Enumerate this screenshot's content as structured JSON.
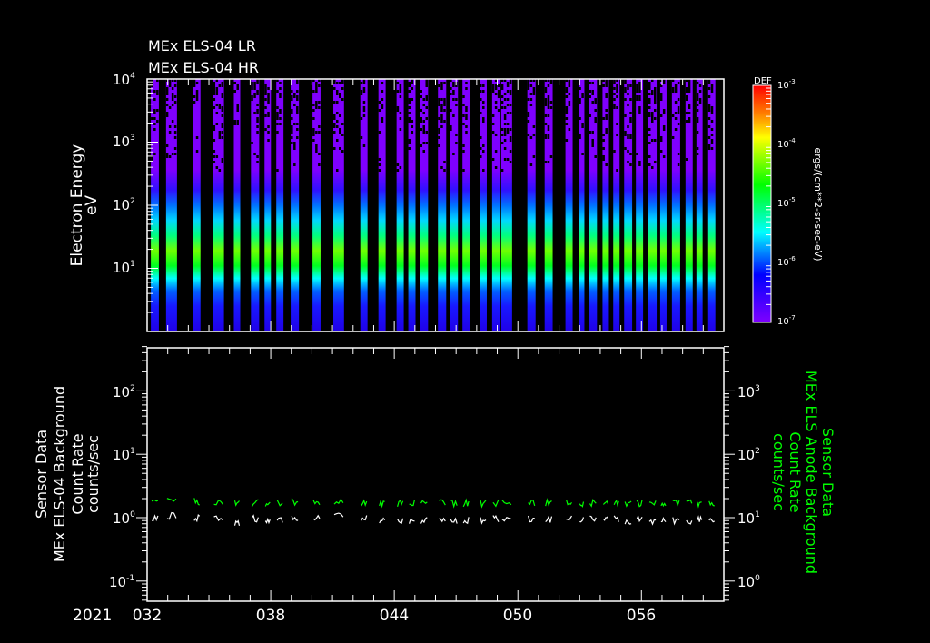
{
  "colors": {
    "background": "#000000",
    "axis": "#ffffff",
    "green_trace": "#00ff00",
    "white_trace": "#ffffff"
  },
  "chart_data": [
    {
      "type": "heatmap",
      "title_lines": [
        "MEx ELS-04 LR",
        "MEx ELS-04 HR"
      ],
      "ylabel": "Electron Energy",
      "yunit": "eV",
      "yscale": "log",
      "ylim": [
        1,
        10000
      ],
      "yticks": [
        {
          "base": "10",
          "exp": "4"
        },
        {
          "base": "10",
          "exp": "3"
        },
        {
          "base": "10",
          "exp": "2"
        },
        {
          "base": "10",
          "exp": "1"
        }
      ],
      "xlim_day": [
        32,
        60
      ],
      "colorbar": {
        "label": "DEF",
        "unit": "ergs/(cm**2-sr-sec-eV)",
        "scale": "log",
        "range": [
          1e-07,
          0.001
        ],
        "ticks": [
          {
            "base": "10",
            "exp": "-3"
          },
          {
            "base": "10",
            "exp": "-4"
          },
          {
            "base": "10",
            "exp": "-5"
          },
          {
            "base": "10",
            "exp": "-6"
          },
          {
            "base": "10",
            "exp": "-7"
          }
        ]
      },
      "passes_day": [
        [
          32.18,
          32.57
        ],
        [
          32.92,
          33.45
        ],
        [
          34.24,
          34.59
        ],
        [
          35.2,
          35.73
        ],
        [
          36.21,
          36.52
        ],
        [
          37.04,
          37.44
        ],
        [
          37.7,
          38.01
        ],
        [
          38.27,
          38.62
        ],
        [
          38.97,
          39.37
        ],
        [
          40.03,
          40.42
        ],
        [
          41.04,
          41.56
        ],
        [
          42.35,
          42.7
        ],
        [
          43.23,
          43.58
        ],
        [
          44.11,
          44.46
        ],
        [
          44.68,
          45.03
        ],
        [
          45.25,
          45.64
        ],
        [
          46.12,
          46.52
        ],
        [
          46.69,
          47.09
        ],
        [
          47.31,
          47.66
        ],
        [
          48.14,
          48.49
        ],
        [
          48.75,
          49.11
        ],
        [
          49.19,
          49.72
        ],
        [
          50.46,
          50.86
        ],
        [
          51.3,
          51.69
        ],
        [
          52.31,
          52.66
        ],
        [
          52.96,
          53.23
        ],
        [
          53.45,
          53.84
        ],
        [
          54.11,
          54.42
        ],
        [
          54.63,
          54.94
        ],
        [
          55.16,
          55.55
        ],
        [
          55.73,
          56.08
        ],
        [
          56.34,
          56.74
        ],
        [
          56.91,
          57.22
        ],
        [
          57.48,
          57.88
        ],
        [
          58.14,
          58.49
        ],
        [
          58.67,
          58.97
        ],
        [
          59.24,
          59.59
        ]
      ],
      "peak_energy_eV": 20,
      "peak_def": 5e-05
    },
    {
      "type": "line",
      "left_axis": {
        "title_lines": [
          "Sensor Data",
          "MEx ELS-04 Background",
          "Count Rate",
          "counts/sec"
        ],
        "scale": "log",
        "ylim": [
          0.05,
          500
        ],
        "yticks": [
          {
            "base": "10",
            "exp": "2"
          },
          {
            "base": "10",
            "exp": "1"
          },
          {
            "base": "10",
            "exp": "0"
          },
          {
            "base": "10",
            "exp": "-1"
          }
        ]
      },
      "right_axis": {
        "title_lines": [
          "Sensor Data",
          "MEx ELS Anode Background",
          "Count Rate",
          "counts/sec"
        ],
        "scale": "log",
        "ylim": [
          0.5,
          5000
        ],
        "yticks": [
          {
            "base": "10",
            "exp": "3"
          },
          {
            "base": "10",
            "exp": "2"
          },
          {
            "base": "10",
            "exp": "1"
          },
          {
            "base": "10",
            "exp": "0"
          }
        ]
      },
      "series": [
        {
          "name": "MEx ELS-04 Background",
          "axis": "left",
          "color": "#ffffff",
          "values": [
            1.0,
            1.05,
            1.0,
            1.0,
            0.85,
            0.95,
            0.95,
            0.95,
            0.95,
            0.95,
            1.05,
            0.95,
            0.9,
            0.9,
            0.9,
            0.9,
            0.95,
            0.9,
            0.9,
            0.9,
            0.95,
            1.0,
            0.95,
            0.95,
            0.95,
            0.95,
            0.95,
            0.95,
            0.95,
            0.9,
            0.95,
            0.9,
            0.95,
            0.9,
            0.9,
            0.9,
            0.95
          ]
        },
        {
          "name": "MEx ELS Anode Background",
          "axis": "right",
          "color": "#00ff00",
          "values": [
            19,
            19,
            18,
            18,
            17,
            17,
            17,
            17,
            18,
            17,
            18,
            17,
            17,
            17,
            17,
            17,
            17,
            17,
            17,
            17,
            17,
            18,
            17,
            17,
            17,
            17,
            17,
            17,
            17,
            17,
            17,
            17,
            17,
            17,
            17,
            17,
            17
          ]
        }
      ]
    }
  ],
  "xaxis": {
    "year": "2021",
    "tick_labels": [
      {
        "label": "032",
        "day": 32
      },
      {
        "label": "038",
        "day": 38
      },
      {
        "label": "044",
        "day": 44
      },
      {
        "label": "050",
        "day": 50
      },
      {
        "label": "056",
        "day": 56
      }
    ]
  }
}
